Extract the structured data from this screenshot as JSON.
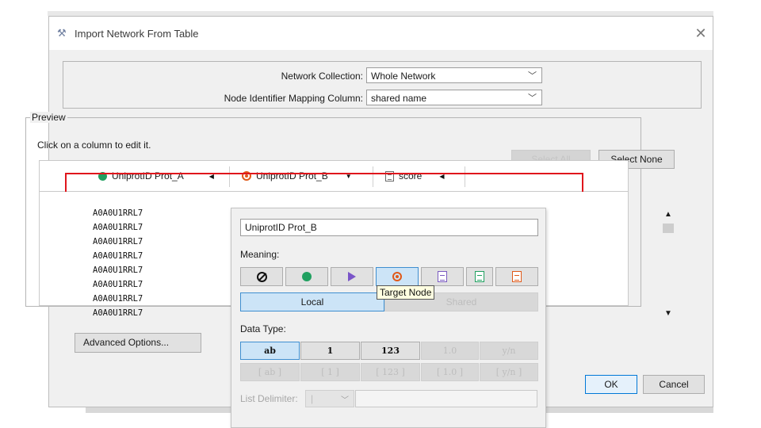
{
  "window": {
    "title": "Import Network From Table",
    "close_symbol": "✕",
    "icon": "tool-icon"
  },
  "top_form": {
    "collection_label": "Network Collection:",
    "collection_value": "Whole Network",
    "mapping_label": "Node Identifier Mapping Column:",
    "mapping_value": "shared name"
  },
  "preview": {
    "legend": "Preview",
    "hint": "Click on a column to edit it.",
    "select_all": "Select All",
    "select_none": "Select None",
    "columns": [
      {
        "label": "UniprotID Prot_A",
        "icon": "source-node-icon"
      },
      {
        "label": "UniprotID Prot_B",
        "icon": "target-node-icon"
      },
      {
        "label": "score",
        "icon": "attribute-icon"
      }
    ],
    "rows": [
      "A0A0U1RRL7",
      "A0A0U1RRL7",
      "A0A0U1RRL7",
      "A0A0U1RRL7",
      "A0A0U1RRL7",
      "A0A0U1RRL7",
      "A0A0U1RRL7",
      "A0A0U1RRL7"
    ]
  },
  "popup": {
    "name_value": "UniprotID Prot_B",
    "meaning_label": "Meaning:",
    "local_label": "Local",
    "shared_label": "Shared",
    "tooltip": "Target Node",
    "data_type_label": "Data Type:",
    "types_row1": [
      "ab",
      "1",
      "123",
      "1.0",
      "y/n"
    ],
    "types_row2": [
      "[ ab ]",
      "[ 1 ]",
      "[ 123 ]",
      "[ 1.0 ]",
      "[ y/n ]"
    ],
    "list_delimiter_label": "List Delimiter:",
    "list_delimiter_value": "|"
  },
  "footer": {
    "advanced": "Advanced Options...",
    "ok": "OK",
    "cancel": "Cancel"
  },
  "colors": {
    "source": "#20a060",
    "target": "#e05a1a",
    "highlight": "#e0161c",
    "selected_bg": "#cce4f7"
  }
}
